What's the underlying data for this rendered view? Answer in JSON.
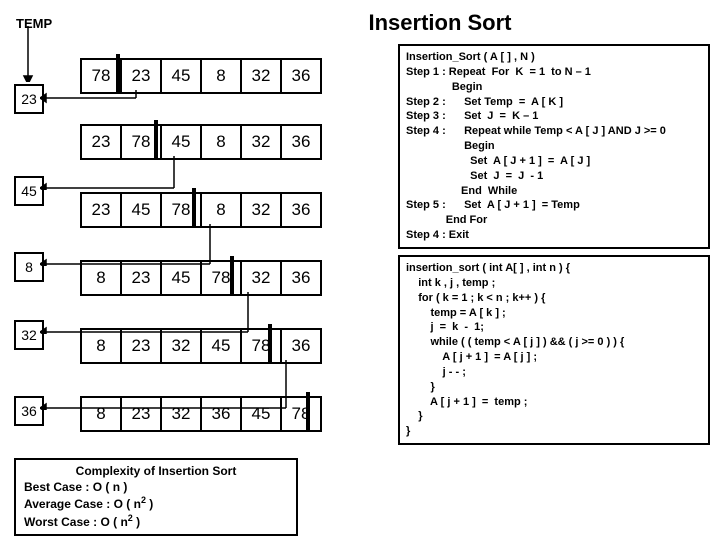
{
  "title": "Insertion Sort",
  "temp_label": "TEMP",
  "temps": [
    "23",
    "45",
    "8",
    "32",
    "36"
  ],
  "arrays": [
    [
      "78",
      "23",
      "45",
      "8",
      "32",
      "36"
    ],
    [
      "23",
      "78",
      "45",
      "8",
      "32",
      "36"
    ],
    [
      "23",
      "45",
      "78",
      "8",
      "32",
      "36"
    ],
    [
      "8",
      "23",
      "45",
      "78",
      "32",
      "36"
    ],
    [
      "8",
      "23",
      "32",
      "45",
      "78",
      "36"
    ],
    [
      "8",
      "23",
      "32",
      "36",
      "45",
      "78"
    ]
  ],
  "sorted_bar_after_index": [
    0,
    1,
    2,
    3,
    4,
    5
  ],
  "pseudocode": "Insertion_Sort ( A [ ] , N )\nStep 1 : Repeat  For  K  = 1  to N – 1\n               Begin\nStep 2 :      Set Temp  =  A [ K ]\nStep 3 :      Set  J  =  K – 1\nStep 4 :      Repeat while Temp < A [ J ] AND J >= 0\n                   Begin\n                     Set  A [ J + 1 ]  =  A [ J ]\n                     Set  J  =  J  - 1\n                  End  While\nStep 5 :      Set  A [ J + 1 ]  = Temp\n             End For\nStep 4 : Exit",
  "ccode": "insertion_sort ( int A[ ] , int n ) {\n    int k , j , temp ;\n    for ( k = 1 ; k < n ; k++ ) {\n        temp = A [ k ] ;\n        j  =  k  -  1;\n        while ( ( temp < A [ j ] ) && ( j >= 0 ) ) {\n            A [ j + 1 ]  = A [ j ] ;\n            j - - ;\n        }\n        A [ j + 1 ]  =  temp ;\n    }\n}",
  "complexity": {
    "heading": "Complexity of Insertion Sort",
    "best": "Best Case : O ( n )",
    "avg": "Average Case : O ( n",
    "avg2": " )",
    "worst": "Worst Case : O ( n",
    "worst2": " )"
  }
}
